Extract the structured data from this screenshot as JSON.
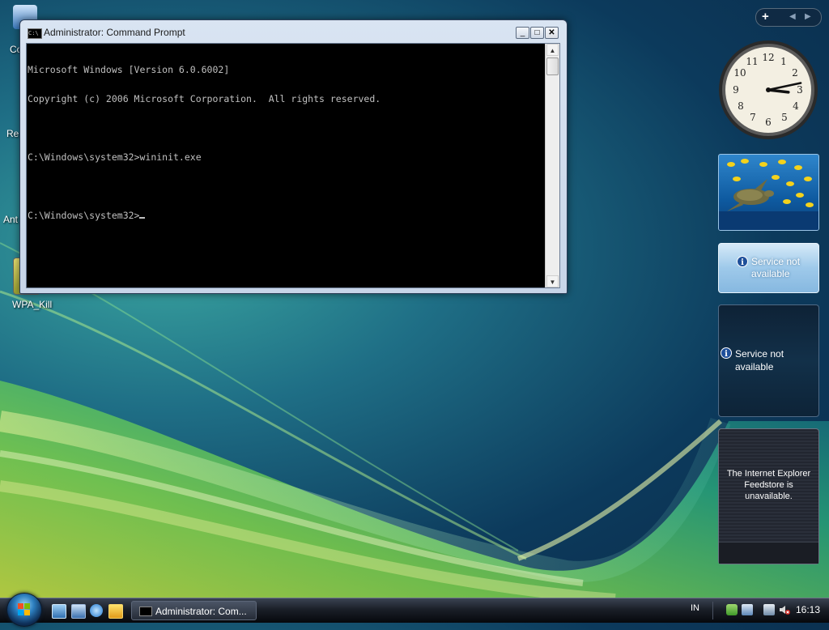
{
  "desktop": {
    "icons": [
      {
        "label": "Co"
      },
      {
        "label": "Re"
      },
      {
        "label": "Ant"
      },
      {
        "label": "WPA_Kill"
      }
    ]
  },
  "cmd_window": {
    "title": "Administrator: Command Prompt",
    "title_icon_text": "C:\\",
    "minimize_label": "_",
    "maximize_label": "□",
    "close_label": "✕",
    "lines": [
      "Microsoft Windows [Version 6.0.6002]",
      "Copyright (c) 2006 Microsoft Corporation.  All rights reserved.",
      "",
      "C:\\Windows\\system32>wininit.exe",
      "",
      "C:\\Windows\\system32>"
    ]
  },
  "sidebar": {
    "add_label": "+",
    "prev_label": "◀",
    "next_label": "▶",
    "clock": {
      "hour": 3,
      "minute": 13,
      "second": 0
    },
    "service_gadget_1": {
      "text": "Service not available",
      "icon": "info-icon"
    },
    "service_gadget_2": {
      "text": "Service not available",
      "icon": "info-icon"
    },
    "feed_gadget": {
      "text": "The Internet Explorer Feedstore is unavailable."
    }
  },
  "taskbar": {
    "task_label": "Administrator: Com...",
    "language": "IN",
    "time": "16:13",
    "quick_launch": [
      "show-desktop-icon",
      "switch-windows-icon",
      "internet-explorer-icon",
      "media-player-icon"
    ],
    "tray": [
      "windows-security-icon",
      "network-icon",
      "volume-muted-icon"
    ]
  },
  "colors": {
    "console_bg": "#000000",
    "console_text": "#c0c0c0",
    "taskbar": "#1a1f28",
    "accent": "#2d7fbf"
  }
}
